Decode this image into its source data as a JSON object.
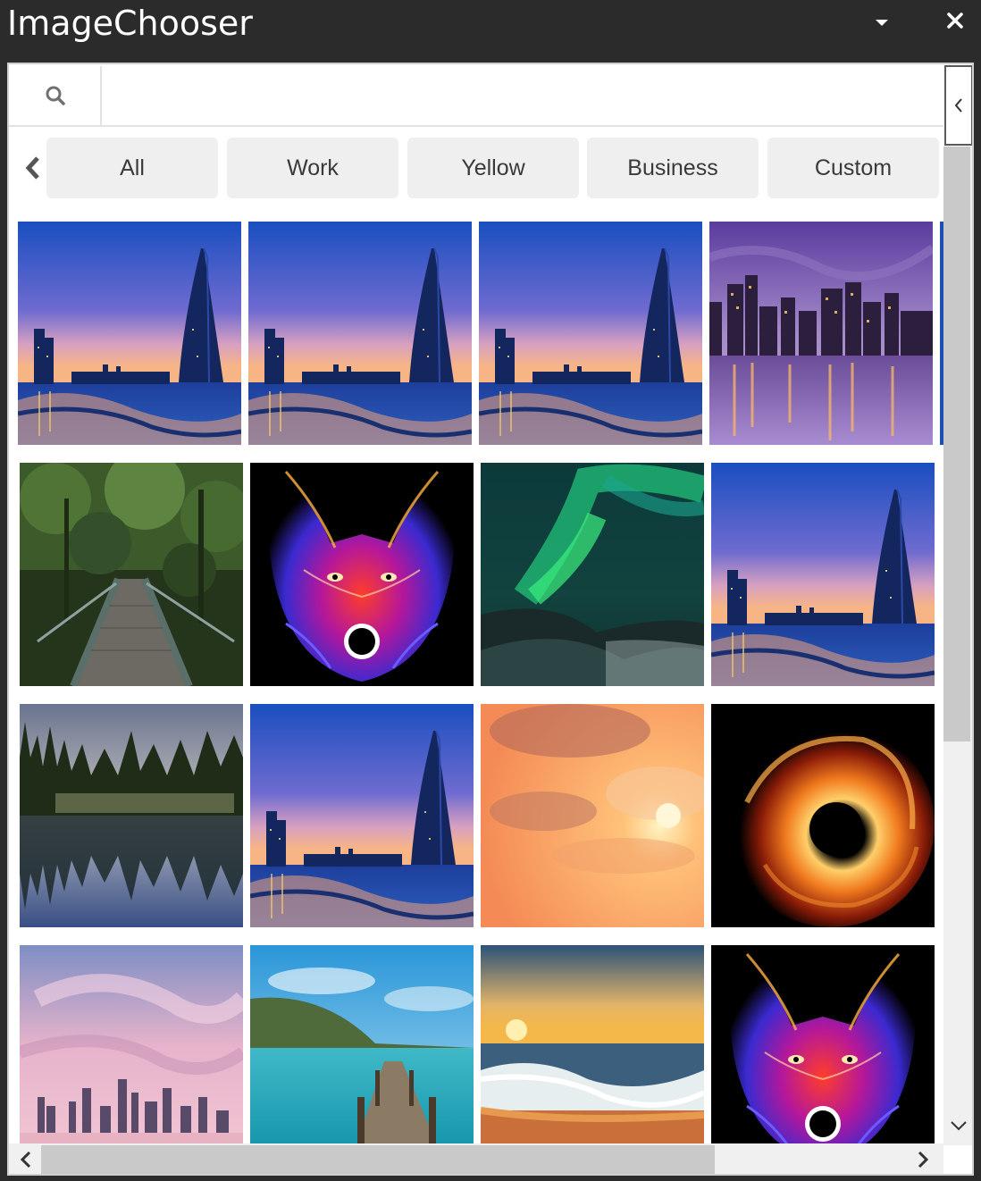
{
  "window": {
    "title": "ImageChooser",
    "dropdown_icon": "caret-down-icon",
    "close_icon": "close-icon",
    "colors": {
      "titlebar": "#2b2b2b",
      "title_text": "#ffffff",
      "content_bg": "#ffffff",
      "tab_bg": "#efefef"
    }
  },
  "search": {
    "icon": "search-icon",
    "value": "",
    "placeholder": ""
  },
  "side_panel": {
    "toggle_icon": "chevron-left-icon"
  },
  "tabs": {
    "prev_icon": "chevron-left-icon",
    "items": [
      {
        "label": "All"
      },
      {
        "label": "Work"
      },
      {
        "label": "Yellow"
      },
      {
        "label": "Business"
      },
      {
        "label": "Custom"
      }
    ]
  },
  "gallery": {
    "tiles": [
      {
        "subject": "burj-al-arab-sunset"
      },
      {
        "subject": "burj-al-arab-sunset"
      },
      {
        "subject": "burj-al-arab-sunset"
      },
      {
        "subject": "city-skyline-night-river"
      },
      {
        "subject": "forest-footbridge"
      },
      {
        "subject": "neon-wolf"
      },
      {
        "subject": "aurora-borealis"
      },
      {
        "subject": "burj-al-arab-sunset"
      },
      {
        "subject": "forest-lake-reflection"
      },
      {
        "subject": "burj-al-arab-sunset"
      },
      {
        "subject": "orange-sunset-clouds"
      },
      {
        "subject": "fire-vortex"
      },
      {
        "subject": "pink-sky-skyline"
      },
      {
        "subject": "turquoise-pier"
      },
      {
        "subject": "beach-sunset-waves"
      },
      {
        "subject": "neon-wolf"
      }
    ]
  },
  "scrollbars": {
    "vertical_position": 0,
    "vertical_visible_fraction": 0.6,
    "horizontal_position": 0,
    "horizontal_visible_fraction": 0.77,
    "icons": [
      "chevron-down-icon",
      "chevron-left-icon",
      "chevron-right-icon"
    ]
  }
}
